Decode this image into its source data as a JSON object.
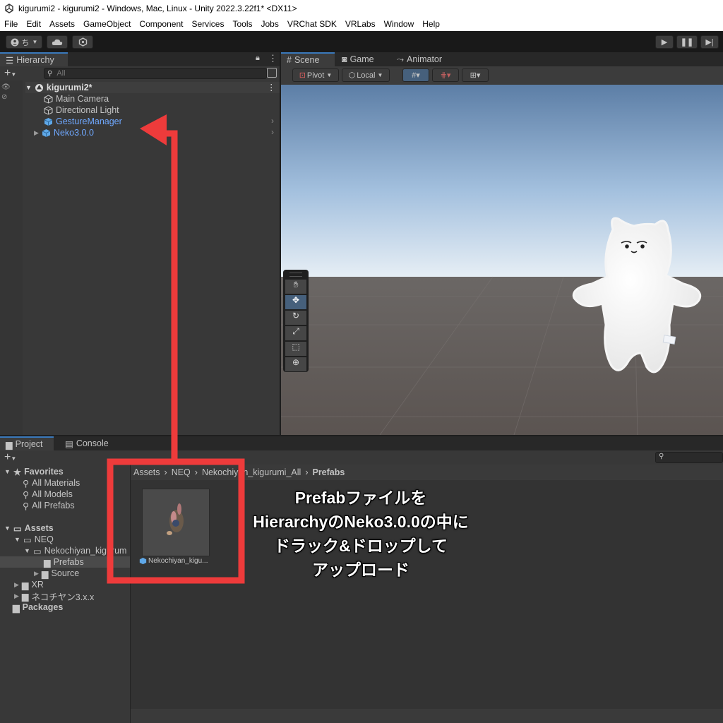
{
  "window": {
    "title": "kigurumi2 - kigurumi2 - Windows, Mac, Linux - Unity 2022.3.22f1* <DX11>"
  },
  "menu": [
    "File",
    "Edit",
    "Assets",
    "GameObject",
    "Component",
    "Services",
    "Tools",
    "Jobs",
    "VRChat SDK",
    "VRLabs",
    "Window",
    "Help"
  ],
  "toolbar": {
    "account_label": "ち"
  },
  "hierarchy": {
    "tab": "Hierarchy",
    "search_placeholder": "All",
    "scene": "kigurumi2*",
    "items": [
      "Main Camera",
      "Directional Light",
      "GestureManager",
      "Neko3.0.0"
    ]
  },
  "scene_tabs": [
    "Scene",
    "Game",
    "Animator"
  ],
  "scene_toolbar": {
    "pivot": "Pivot",
    "local": "Local"
  },
  "project": {
    "tabs": [
      "Project",
      "Console"
    ],
    "favorites_label": "Favorites",
    "favorites": [
      "All Materials",
      "All Models",
      "All Prefabs"
    ],
    "assets_label": "Assets",
    "tree": [
      "NEQ",
      "Nekochiyan_kigurum",
      "Prefabs",
      "Source",
      "XR",
      "ネコチヤン3.x.x"
    ],
    "packages_label": "Packages",
    "breadcrumb": [
      "Assets",
      "NEQ",
      "Nekochiyan_kigurumi_All",
      "Prefabs"
    ],
    "asset_name": "Nekochiyan_kigu..."
  },
  "annotation": {
    "lines": [
      "Prefabファイルを",
      "HierarchyのNeko3.0.0の中に",
      "ドラック&ドロップして",
      "アップロード"
    ],
    "color": "#ee3b3b"
  }
}
